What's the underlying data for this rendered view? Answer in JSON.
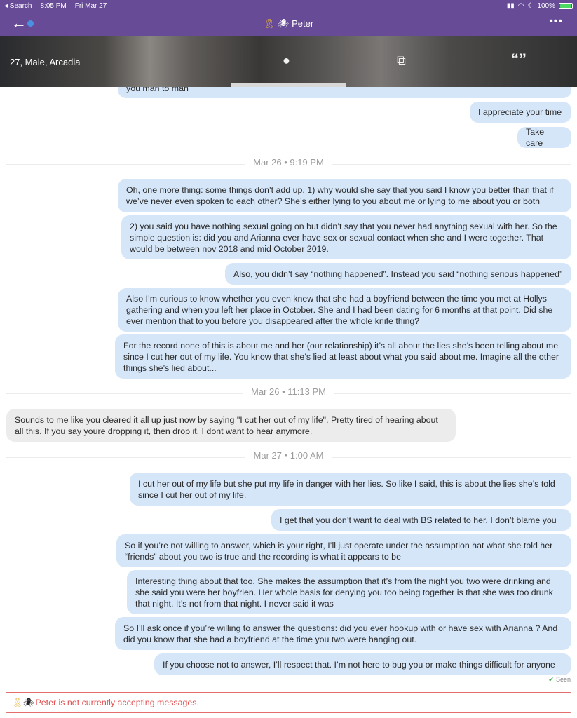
{
  "status_bar": {
    "back_app": "◂ Search",
    "time": "8:05 PM",
    "date": "Fri Mar 27",
    "battery": "100%"
  },
  "header": {
    "back_icon": "←",
    "ribbon": "🎗",
    "spider": "🕷",
    "name": "Peter",
    "more": "•••"
  },
  "profile": {
    "info": "27, Male, Arcadia",
    "chat_icon": "●",
    "photos_icon": "⧉",
    "quote_icon": "“”"
  },
  "messages": [
    {
      "dir": "out",
      "text": "you man to man"
    },
    {
      "dir": "out",
      "text": "I appreciate your time"
    },
    {
      "dir": "out",
      "text": "Take care"
    },
    {
      "date": "Mar 26 • 9:19 PM"
    },
    {
      "dir": "out",
      "text": "Oh, one more thing: some things don’t add up. 1) why would she say that you said I know you better than that if we’ve never even spoken to each other? She’s either lying to you about me or lying to me about you or both"
    },
    {
      "dir": "out",
      "text": "2) you said you have nothing sexual going on but didn’t say that you never had anything sexual with her. So the simple question is: did you and Arianna ever have sex or sexual contact when she and I were together. That would be between nov 2018 and mid October 2019."
    },
    {
      "dir": "out",
      "text": "Also, you didn’t say “nothing happened”. Instead you said “nothing serious happened”"
    },
    {
      "dir": "out",
      "text": "Also I’m curious to know whether you even knew that she had a boyfriend between the time you met at Hollys gathering and when you left her place in October. She and I had been dating for 6 months at that point. Did she ever mention that to you before you disappeared after the whole knife thing?"
    },
    {
      "dir": "out",
      "text": "For the record none of this is about me and her (our relationship) it’s all about the lies she’s been telling about me since I cut her out of my life. You know that she’s lied at least about what you said about me. Imagine all the other things she’s lied about..."
    },
    {
      "date": "Mar 26 • 11:13 PM"
    },
    {
      "dir": "in",
      "text": "Sounds to me like you cleared it all up just now by saying \"I cut her out of my life\".  Pretty tired of hearing about all this. If you say youre dropping it, then drop it. I dont want to hear anymore."
    },
    {
      "date": "Mar 27 • 1:00 AM"
    },
    {
      "dir": "out",
      "text": "I cut her out of my life but she put my life in danger with her lies. So like I said, this is about the lies she’s told since I cut her out of my life."
    },
    {
      "dir": "out",
      "text": "I get that you don’t want to deal with BS related to her. I don’t blame you"
    },
    {
      "dir": "out",
      "text": "So if you’re not willing to answer, which is your right, I’ll just operate under the assumption hat what she told her “friends” about you two is true and the recording is what it appears to be"
    },
    {
      "dir": "out",
      "text": "Interesting thing about that too. She makes the assumption that it’s from the night you two were drinking and she said you were her boyfrien. Her whole basis for denying you too being together is that she was too drunk that night. It’s not from that night. I never said it was"
    },
    {
      "dir": "out",
      "text": "So I’ll ask once if you’re willing to answer the questions: did you ever hookup with or have sex with Arianna ? And did you know that she had a boyfriend at the time you two were hanging out."
    },
    {
      "dir": "out",
      "text": "If you choose not to answer, I’ll respect that. I’m not here to bug you or make things difficult for anyone"
    }
  ],
  "seen": {
    "check": "✔",
    "label": "Seen"
  },
  "notice": {
    "ribbon": "🎗",
    "spider": "🕷",
    "text": "Peter is not currently accepting messages."
  }
}
